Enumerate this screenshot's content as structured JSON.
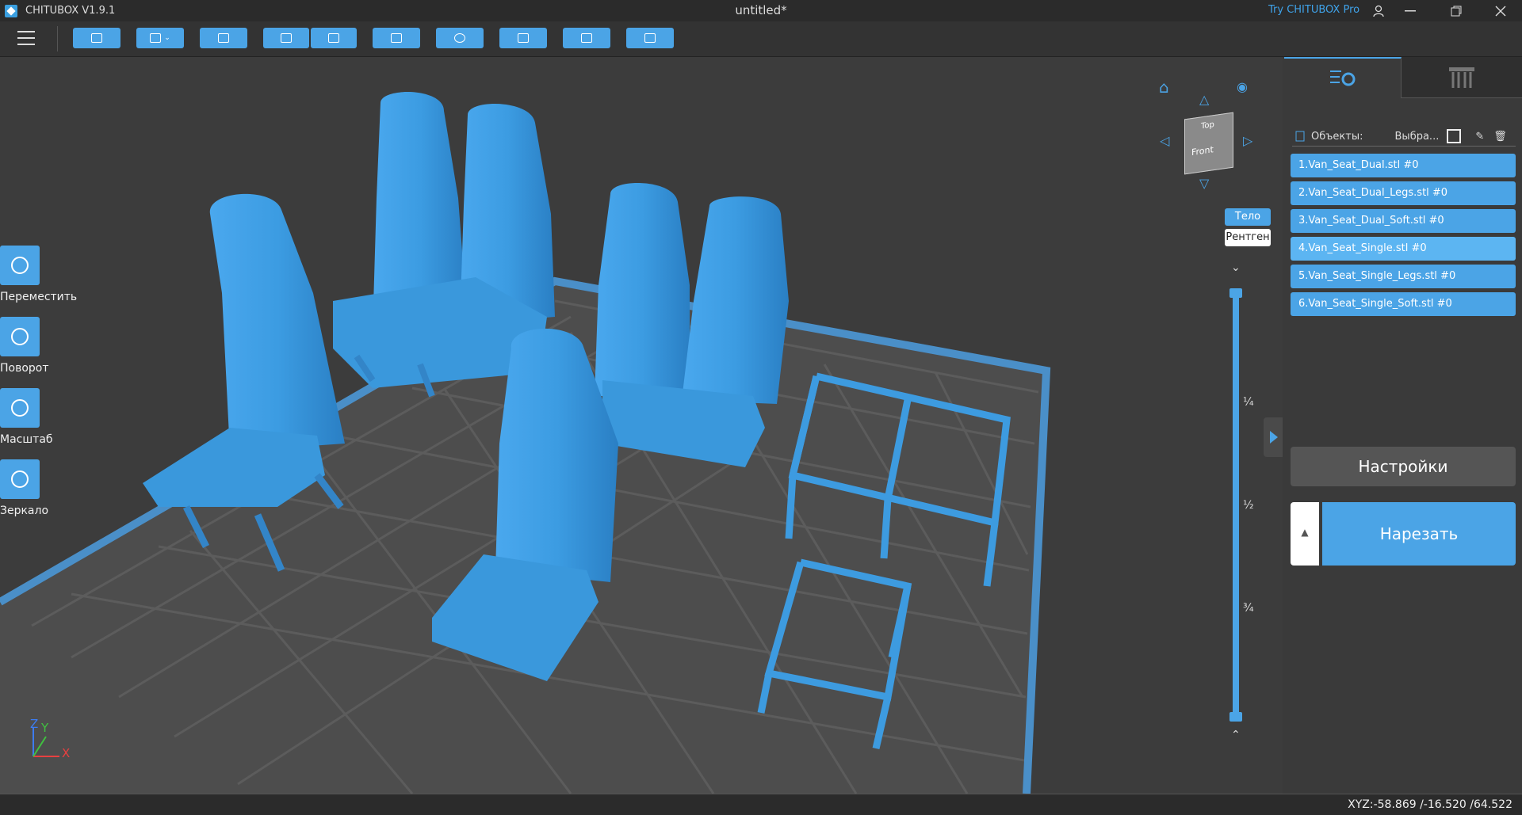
{
  "titlebar": {
    "app_name": "CHITUBOX V1.9.1",
    "doc_title": "untitled*",
    "pro_link": "Try CHITUBOX Pro"
  },
  "toolbar": {
    "buttons": [
      "open-icon",
      "save-icon",
      "fit-icon",
      "import-icon",
      "export-icon",
      "clipboard-icon",
      "arrange-icon",
      "support-icon",
      "hollow-icon",
      "printer-icon"
    ]
  },
  "left_tools": [
    {
      "label": "Переместить",
      "icon": "move-icon"
    },
    {
      "label": "Поворот",
      "icon": "rotate-icon"
    },
    {
      "label": "Масштаб",
      "icon": "scale-icon"
    },
    {
      "label": "Зеркало",
      "icon": "mirror-icon"
    }
  ],
  "view": {
    "cube_top": "Top",
    "cube_front": "Front",
    "mode_body": "Тело",
    "mode_xray": "Рентген",
    "slider_labels": [
      "¼",
      "½",
      "¾"
    ]
  },
  "panel": {
    "objects_label": "Объекты:",
    "select_label": "Выбра...",
    "objects": [
      "1.Van_Seat_Dual.stl #0",
      "2.Van_Seat_Dual_Legs.stl #0",
      "3.Van_Seat_Dual_Soft.stl #0",
      "4.Van_Seat_Single.stl #0",
      "5.Van_Seat_Single_Legs.stl #0",
      "6.Van_Seat_Single_Soft.stl #0"
    ],
    "selected_index": 3,
    "settings_label": "Настройки",
    "slice_label": "Нарезать"
  },
  "axes": {
    "z": "Z",
    "y": "Y",
    "x": "X"
  },
  "status": {
    "xyz": "XYZ:-58.869 /-16.520 /64.522"
  },
  "colors": {
    "accent": "#4ba4e6",
    "model": "#3d9be0",
    "plate": "#4a8fc8"
  }
}
